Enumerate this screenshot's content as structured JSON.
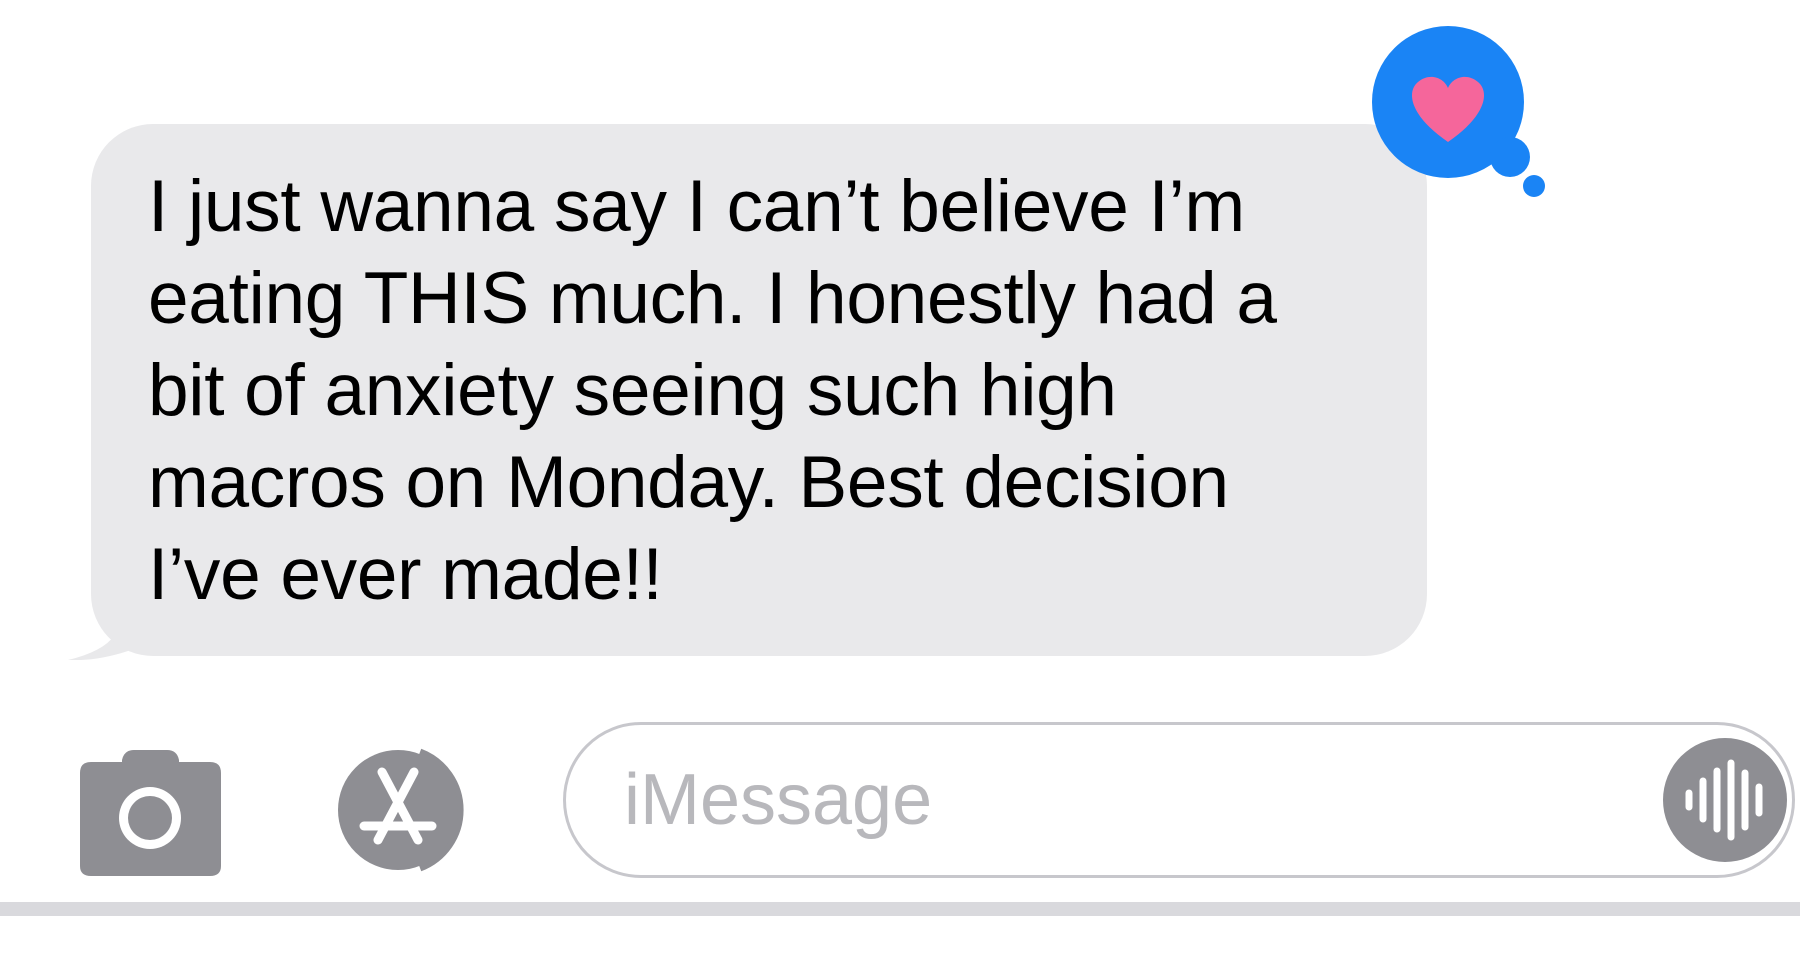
{
  "message": {
    "text": "I just wanna say I can’t believe I’m\neating THIS much. I honestly had a\nbit of anxiety seeing such high\nmacros on Monday. Best decision\nI’ve ever made!!",
    "bubble_color": "#e9e9eb",
    "text_color": "#000000"
  },
  "tapback": {
    "icon": "heart-icon",
    "bubble_color": "#1a84f5",
    "heart_color": "#f5669b"
  },
  "composer": {
    "placeholder": "iMessage",
    "value": "",
    "camera_icon": "camera-icon",
    "apps_icon": "app-store-icon",
    "audio_icon": "audio-waveform-icon",
    "icon_color": "#8e8e93"
  }
}
